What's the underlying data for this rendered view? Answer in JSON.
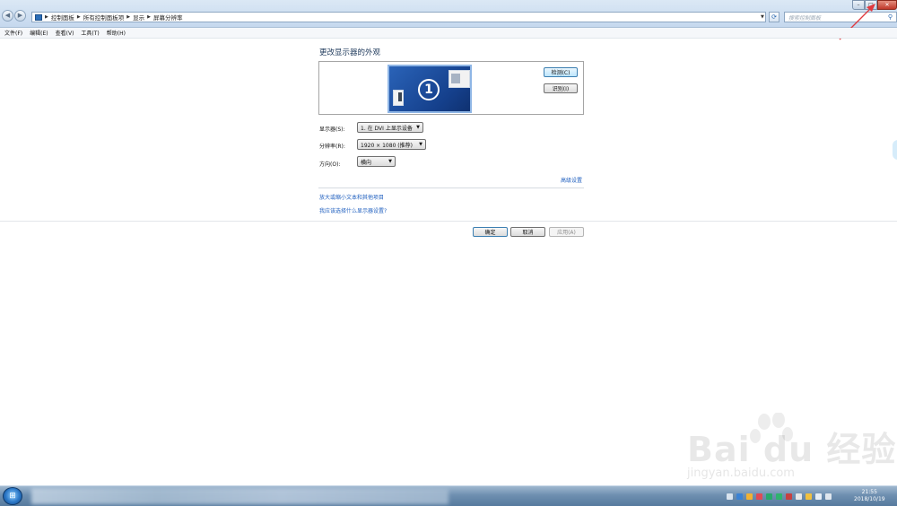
{
  "address_bar": {
    "breadcrumbs": [
      "控制面板",
      "所有控制面板项",
      "显示",
      "屏幕分辨率"
    ],
    "search_placeholder": "搜索控制面板"
  },
  "menu": [
    "文件(F)",
    "编辑(E)",
    "查看(V)",
    "工具(T)",
    "帮助(H)"
  ],
  "main": {
    "heading": "更改显示器的外观",
    "monitor_number": "1",
    "detect_label": "检测(C)",
    "identify_label": "识别(I)",
    "display_label": "显示器(S):",
    "display_value": "1. 在 DVI 上显示设备",
    "resolution_label": "分辨率(R):",
    "resolution_value": "1920 × 1080 (推荐)",
    "orientation_label": "方向(O):",
    "orientation_value": "横向",
    "advanced_link": "高级设置",
    "link_text_size": "放大或缩小文本和其他项目",
    "link_which_settings": "我应该选择什么显示器设置?"
  },
  "footer": {
    "ok_label": "确定",
    "cancel_label": "取消",
    "apply_label": "应用(A)"
  },
  "watermark": {
    "logo": "Bai du 经验",
    "url": "jingyan.baidu.com"
  },
  "taskbar": {
    "time": "21:55",
    "date": "2018/10/19"
  },
  "colors": {
    "link": "#1f5fbf",
    "heading": "#1e395b",
    "monitor_blue": "#15408c",
    "close_red": "#c0392b"
  }
}
